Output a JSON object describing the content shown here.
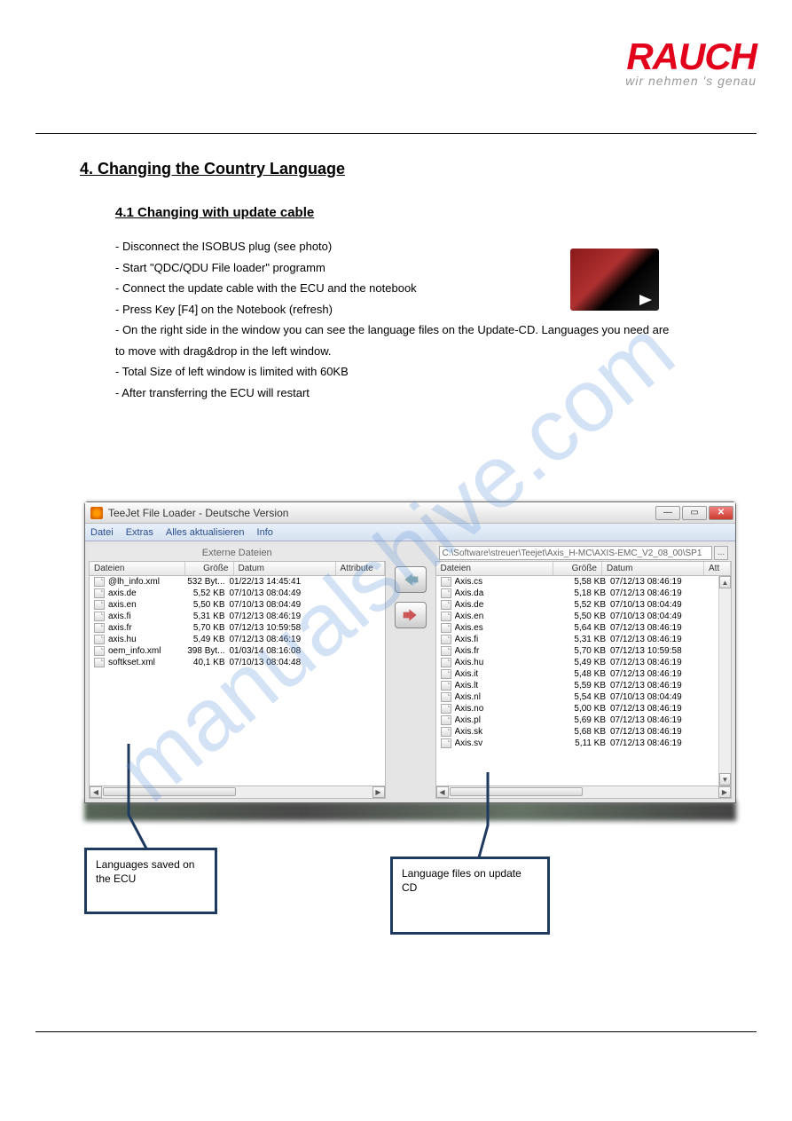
{
  "logo": {
    "name": "RAUCH",
    "tagline": "wir nehmen 's genau"
  },
  "section": {
    "number": "4.",
    "title": "Changing the Country Language"
  },
  "subsection": {
    "number": "4.1",
    "title": "Changing with update cable"
  },
  "instructions": [
    "- Disconnect the ISOBUS plug (see photo)",
    "- Start \"QDC/QDU File loader\" programm",
    "- Connect the update cable with the ECU and the notebook",
    "- Press Key [F4] on the Notebook (refresh)",
    "- On the right side in the window you can see the language files on the Update-CD. Languages you need are",
    "  to move with drag&drop in the left window.",
    "- Total Size of left window is limited with 60KB",
    "- After transferring the ECU will restart"
  ],
  "window": {
    "title": "TeeJet File Loader - Deutsche Version",
    "buttons": {
      "min": "—",
      "max": "▭",
      "close": "✕"
    },
    "menu": [
      "Datei",
      "Extras",
      "Alles aktualisieren",
      "Info"
    ],
    "left": {
      "header_label": "Externe Dateien",
      "columns": [
        "Dateien",
        "Größe",
        "Datum",
        "Attribute"
      ],
      "files": [
        {
          "name": "@lh_info.xml",
          "size": "532 Byt...",
          "date": "01/22/13 14:45:41"
        },
        {
          "name": "axis.de",
          "size": "5,52 KB",
          "date": "07/10/13 08:04:49"
        },
        {
          "name": "axis.en",
          "size": "5,50 KB",
          "date": "07/10/13 08:04:49"
        },
        {
          "name": "axis.fi",
          "size": "5,31 KB",
          "date": "07/12/13 08:46:19"
        },
        {
          "name": "axis.fr",
          "size": "5,70 KB",
          "date": "07/12/13 10:59:58"
        },
        {
          "name": "axis.hu",
          "size": "5,49 KB",
          "date": "07/12/13 08:46:19"
        },
        {
          "name": "oem_info.xml",
          "size": "398 Byt...",
          "date": "01/03/14 08:16:08"
        },
        {
          "name": "softkset.xml",
          "size": "40,1 KB",
          "date": "07/10/13 08:04:48"
        }
      ]
    },
    "right": {
      "path": "C:\\Software\\streuer\\Teejet\\Axis_H-MC\\AXIS-EMC_V2_08_00\\SP1",
      "columns": [
        "Dateien",
        "Größe",
        "Datum",
        "Att"
      ],
      "files": [
        {
          "name": "Axis.cs",
          "size": "5,58 KB",
          "date": "07/12/13 08:46:19"
        },
        {
          "name": "Axis.da",
          "size": "5,18 KB",
          "date": "07/12/13 08:46:19"
        },
        {
          "name": "Axis.de",
          "size": "5,52 KB",
          "date": "07/10/13 08:04:49"
        },
        {
          "name": "Axis.en",
          "size": "5,50 KB",
          "date": "07/10/13 08:04:49"
        },
        {
          "name": "Axis.es",
          "size": "5,64 KB",
          "date": "07/12/13 08:46:19"
        },
        {
          "name": "Axis.fi",
          "size": "5,31 KB",
          "date": "07/12/13 08:46:19"
        },
        {
          "name": "Axis.fr",
          "size": "5,70 KB",
          "date": "07/12/13 10:59:58"
        },
        {
          "name": "Axis.hu",
          "size": "5,49 KB",
          "date": "07/12/13 08:46:19"
        },
        {
          "name": "Axis.it",
          "size": "5,48 KB",
          "date": "07/12/13 08:46:19"
        },
        {
          "name": "Axis.lt",
          "size": "5,59 KB",
          "date": "07/12/13 08:46:19"
        },
        {
          "name": "Axis.nl",
          "size": "5,54 KB",
          "date": "07/10/13 08:04:49"
        },
        {
          "name": "Axis.no",
          "size": "5,00 KB",
          "date": "07/12/13 08:46:19"
        },
        {
          "name": "Axis.pl",
          "size": "5,69 KB",
          "date": "07/12/13 08:46:19"
        },
        {
          "name": "Axis.sk",
          "size": "5,68 KB",
          "date": "07/12/13 08:46:19"
        },
        {
          "name": "Axis.sv",
          "size": "5,11 KB",
          "date": "07/12/13 08:46:19"
        }
      ]
    }
  },
  "callouts": {
    "left": "Languages saved on the ECU",
    "right": "Language files on update CD"
  },
  "watermark": "manualshive.com"
}
